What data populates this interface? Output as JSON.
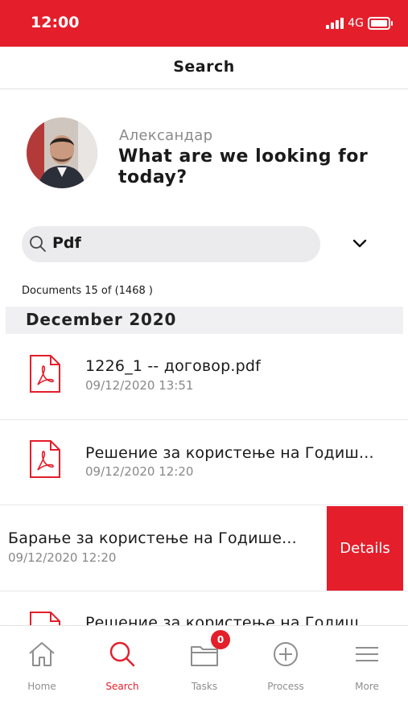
{
  "status_bar": {
    "time": "12:00",
    "network": "4G",
    "background_color": "#e41e2b"
  },
  "header": {
    "title": "Search"
  },
  "greeting": {
    "name": "Александар",
    "question": "What are we looking for today?"
  },
  "search": {
    "value": "Pdf",
    "icon": "search-icon",
    "dropdown_icon": "chevron-down-icon"
  },
  "results": {
    "count_label": "Documents 15 of (1468 )",
    "section": "December 2020",
    "documents": [
      {
        "name": "1226_1 -- договор.pdf",
        "date": "09/12/2020 13:51",
        "icon": "pdf-file-icon"
      },
      {
        "name": "Решение за користење на Годиш...",
        "date": "09/12/2020 12:20",
        "icon": "pdf-file-icon"
      },
      {
        "name": "Барање за користење на Годише...",
        "date": "09/12/2020 12:20",
        "action": "Details"
      },
      {
        "name": "Решение за користење на Годиш",
        "date": "",
        "icon": "pdf-file-icon"
      }
    ]
  },
  "tabbar": {
    "tabs": [
      {
        "label": "Home",
        "icon": "home-icon"
      },
      {
        "label": "Search",
        "icon": "search-icon",
        "active": true
      },
      {
        "label": "Tasks",
        "icon": "folder-icon",
        "badge": "0"
      },
      {
        "label": "Process",
        "icon": "plus-circle-icon"
      },
      {
        "label": "More",
        "icon": "menu-icon"
      }
    ]
  },
  "colors": {
    "accent": "#e41e2b",
    "muted": "#8e8e8e"
  }
}
